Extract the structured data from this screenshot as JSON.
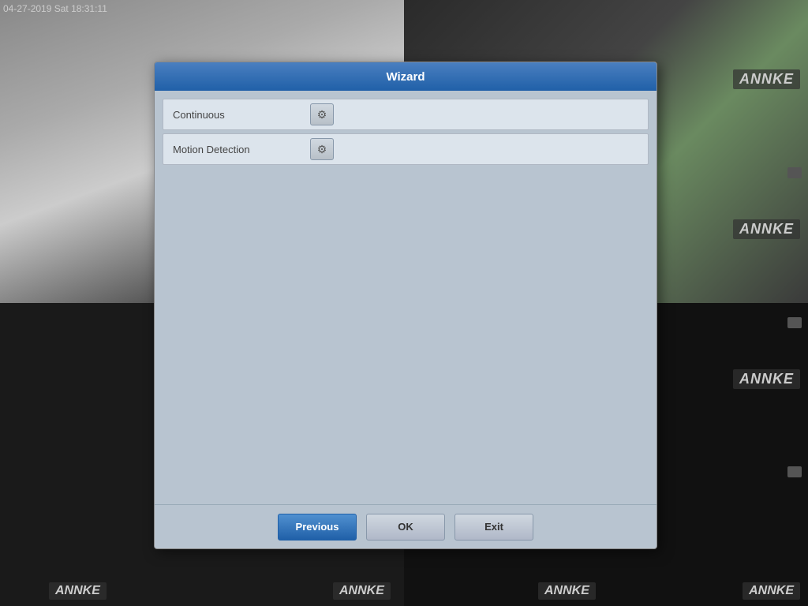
{
  "background": {
    "timestamp": "04-27-2019 Sat 18:31:11",
    "cam1_label": "",
    "cam2_label": "",
    "cam3_label": "",
    "cam4_label": ""
  },
  "annke_logos": {
    "brand": "ANNKE",
    "positions": [
      "top-right-q1",
      "top-right-q2",
      "top-right-q3",
      "top-right-q4"
    ]
  },
  "dialog": {
    "title": "Wizard",
    "rows": [
      {
        "label": "Continuous",
        "icon": "⚙"
      },
      {
        "label": "Motion Detection",
        "icon": "⚙"
      }
    ],
    "buttons": {
      "previous": "Previous",
      "ok": "OK",
      "exit": "Exit"
    }
  }
}
